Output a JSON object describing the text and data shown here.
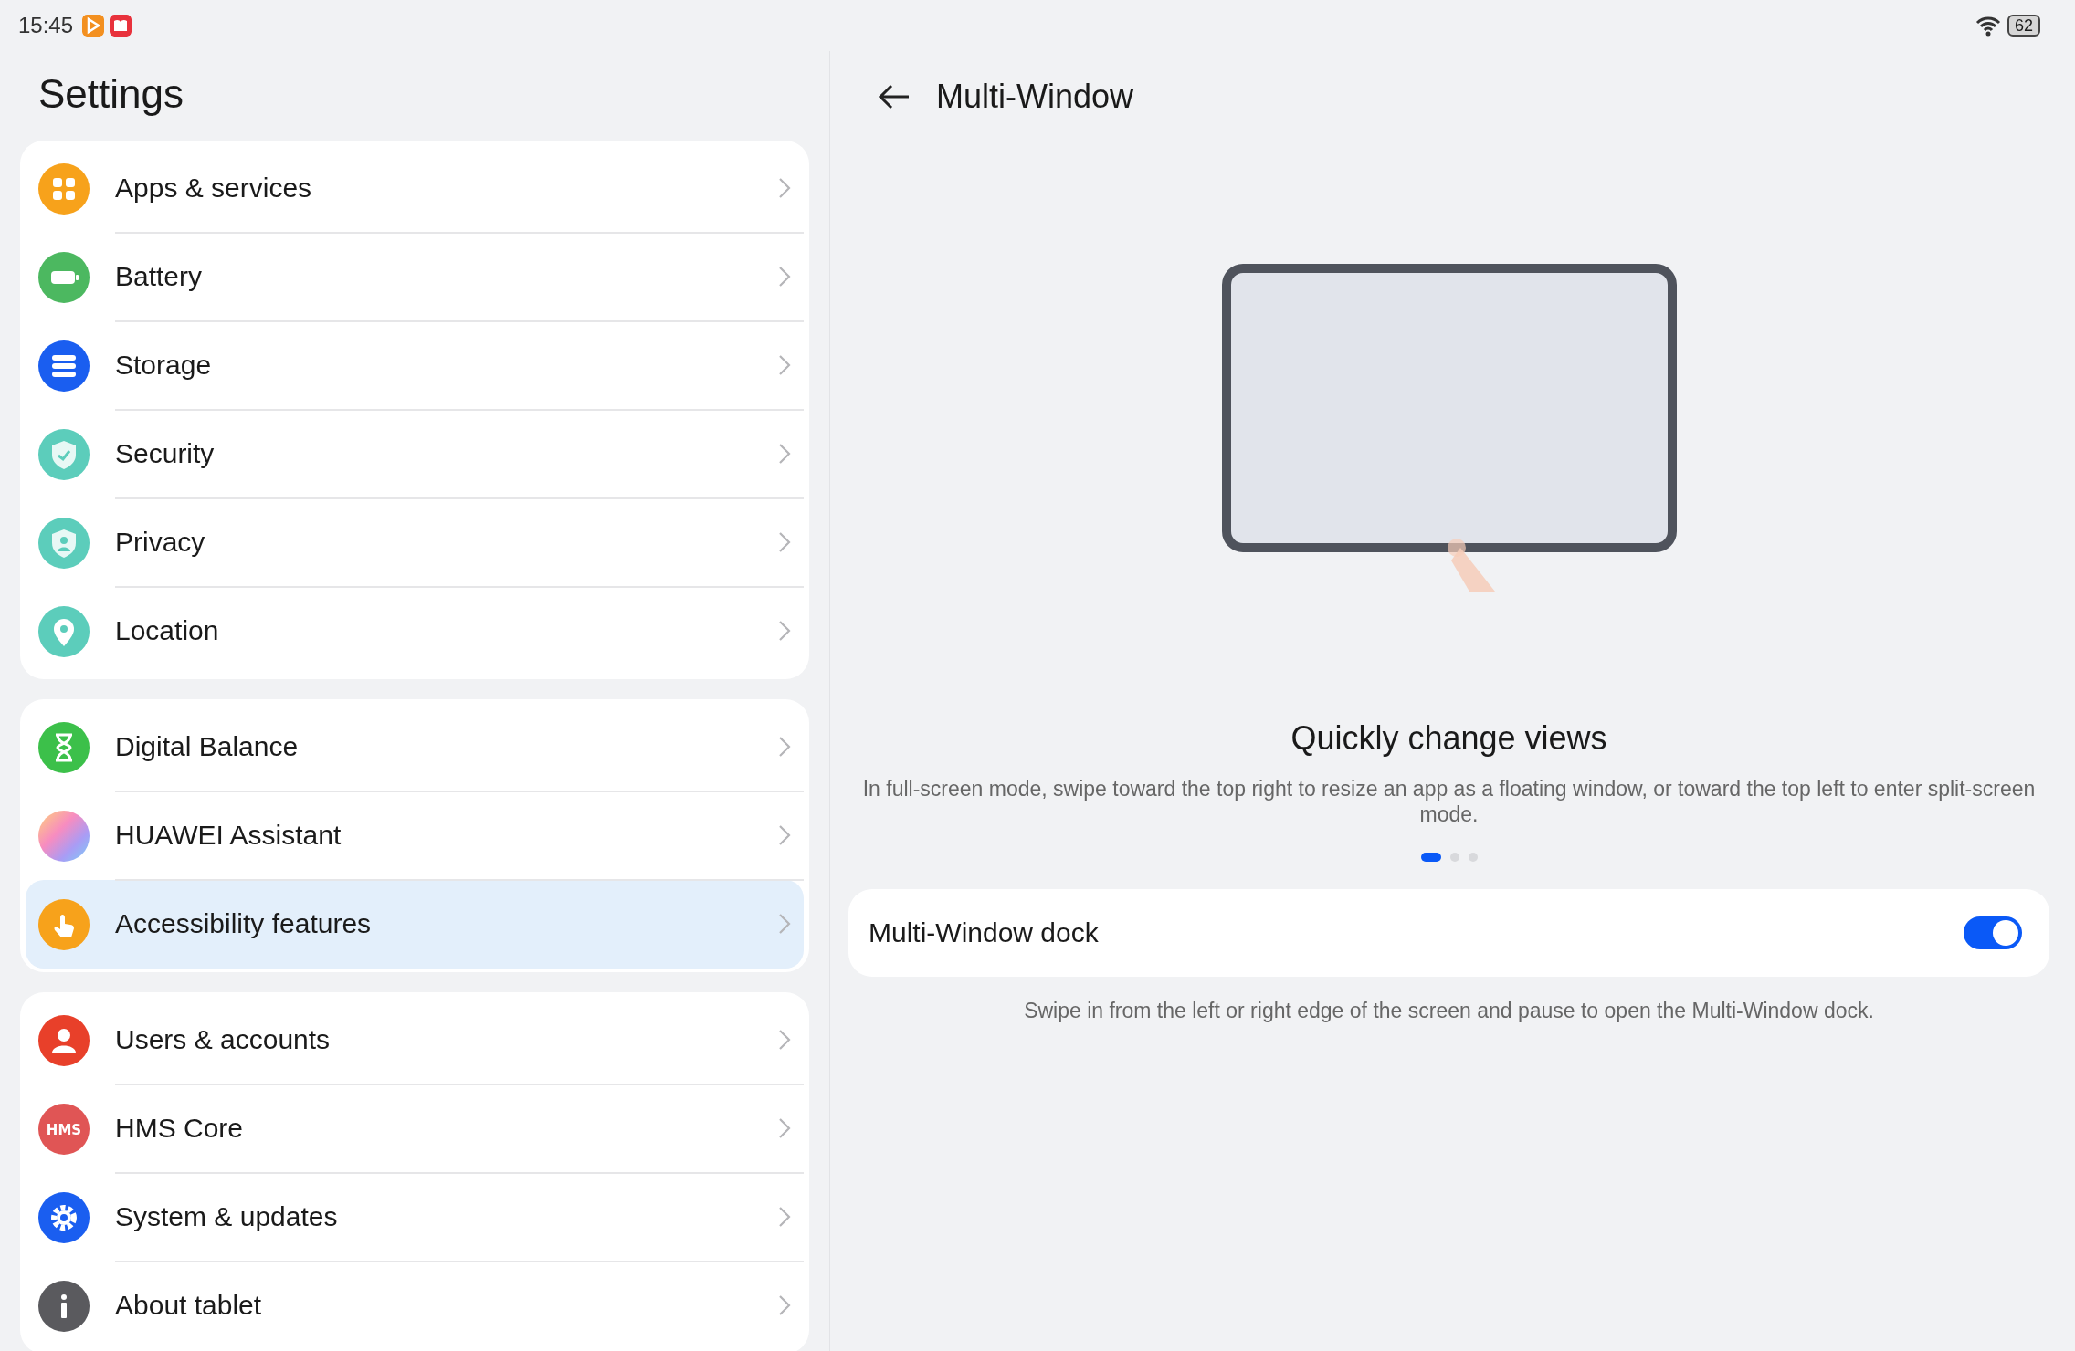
{
  "status_bar": {
    "time": "15:45",
    "battery": "62"
  },
  "sidebar": {
    "title": "Settings",
    "groups": [
      {
        "items": [
          {
            "kind": "apps",
            "label": "Apps & services",
            "selected": false
          },
          {
            "kind": "battery",
            "label": "Battery",
            "selected": false
          },
          {
            "kind": "storage",
            "label": "Storage",
            "selected": false
          },
          {
            "kind": "security",
            "label": "Security",
            "selected": false
          },
          {
            "kind": "privacy",
            "label": "Privacy",
            "selected": false
          },
          {
            "kind": "location",
            "label": "Location",
            "selected": false
          }
        ]
      },
      {
        "items": [
          {
            "kind": "balance",
            "label": "Digital Balance",
            "selected": false
          },
          {
            "kind": "assistant",
            "label": "HUAWEI Assistant",
            "selected": false
          },
          {
            "kind": "accessibility",
            "label": "Accessibility features",
            "selected": true
          }
        ]
      },
      {
        "items": [
          {
            "kind": "users",
            "label": "Users & accounts",
            "selected": false
          },
          {
            "kind": "hms",
            "label": "HMS Core",
            "icon_text": "HMS",
            "selected": false
          },
          {
            "kind": "system",
            "label": "System & updates",
            "selected": false
          },
          {
            "kind": "about",
            "label": "About tablet",
            "selected": false
          }
        ]
      }
    ]
  },
  "page": {
    "title": "Multi-Window",
    "heading": "Quickly change views",
    "description": "In full-screen mode, swipe toward the top right to resize an app as a floating window, or toward the top left to enter split-screen mode.",
    "pager": [
      {
        "selected": true
      },
      {
        "selected": false
      },
      {
        "selected": false
      }
    ],
    "dock": {
      "label": "Multi-Window dock",
      "on": true
    },
    "footer": "Swipe in from the left or right edge of the screen and pause to open the Multi-Window dock."
  }
}
